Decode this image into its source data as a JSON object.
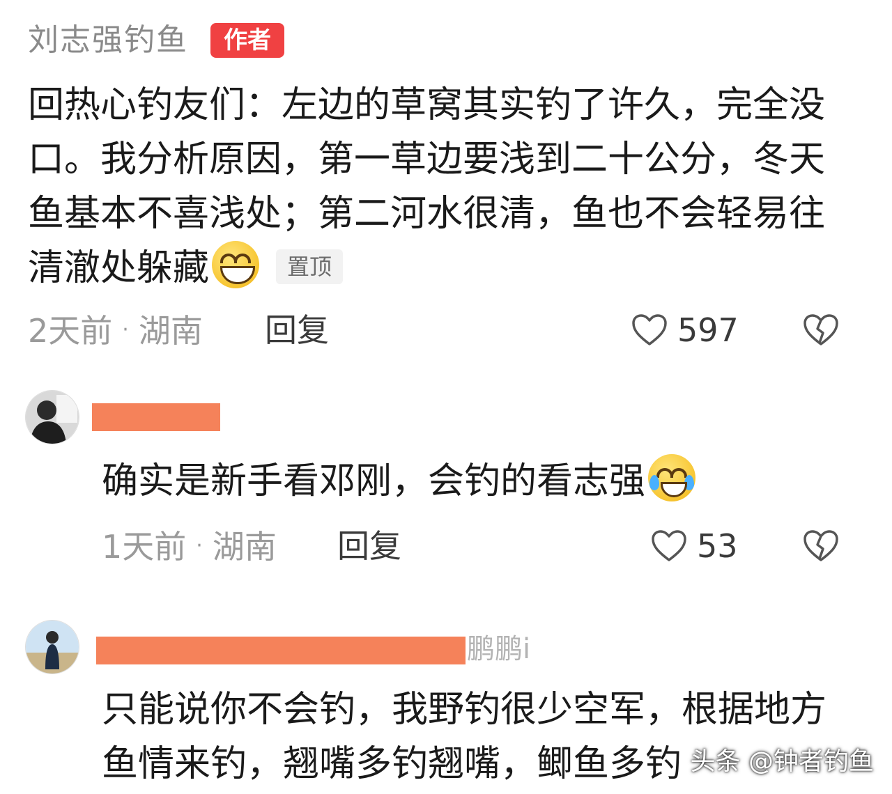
{
  "main_comment": {
    "author": "刘志强钓鱼",
    "author_badge": "作者",
    "text": "回热心钓友们：左边的草窝其实钓了许久，完全没口。我分析原因，第一草边要浅到二十公分，冬天鱼基本不喜浅处；第二河水很清，鱼也不会轻易往清澈处躲藏",
    "emoji_icon": "grinning-face-icon",
    "pinned_label": "置顶",
    "time": "2天前",
    "separator": "·",
    "location": "湖南",
    "reply_label": "回复",
    "likes": "597"
  },
  "replies": [
    {
      "text": "确实是新手看邓刚，会钓的看志强",
      "emoji_icon": "tears-of-joy-icon",
      "time": "1天前",
      "separator": "·",
      "location": "湖南",
      "reply_label": "回复",
      "likes": "53"
    },
    {
      "name_peek": "鹏鹏i",
      "text": "只能说你不会钓，我野钓很少空军，根据地方鱼情来钓，翘嘴多钓翘嘴，鲫鱼多钓"
    }
  ],
  "watermark": "头条 @钟者钓鱼",
  "colors": {
    "author_badge": "#f04142",
    "redaction": "#f5825a",
    "meta_gray": "#9a9a9a"
  }
}
